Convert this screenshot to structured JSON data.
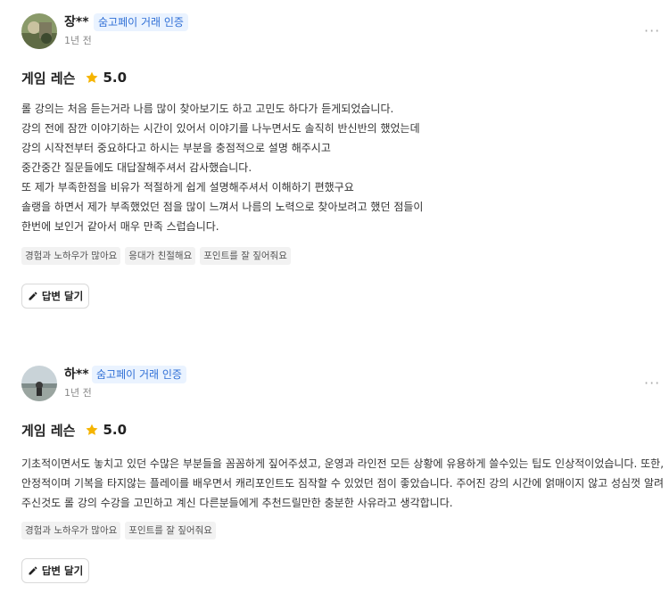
{
  "reviews": [
    {
      "name": "장**",
      "badge": "숨고페이 거래 인증",
      "time": "1년 전",
      "more": "···",
      "title": "게임 레슨",
      "rating": 5.0,
      "rating_text": "5.0",
      "lines": [
        "롤 강의는 처음 듣는거라 나름 많이 찾아보기도 하고 고민도 하다가 듣게되었습니다.",
        "강의 전에 잠깐 이야기하는 시간이 있어서 이야기를 나누면서도 솔직히 반신반의 했었는데",
        "강의 시작전부터 중요하다고 하시는 부분을 충점적으로 설명 해주시고",
        "중간중간 질문들에도 대답잘해주셔서 감사했습니다.",
        "또 제가 부족한점을 비유가 적절하게 쉽게 설명해주셔서 이해하기 편했구요",
        "솔랭을 하면서 제가 부족했었던 점을 많이 느껴서 나름의 노력으로 찾아보려고 했던 점들이",
        "한번에 보인거 같아서 매우 만족 스럽습니다."
      ],
      "tags": [
        "경험과 노하우가 많아요",
        "응대가 친절해요",
        "포인트를 잘 짚어줘요"
      ],
      "reply_label": "답변 달기"
    },
    {
      "name": "하**",
      "badge": "숨고페이 거래 인증",
      "time": "1년 전",
      "more": "···",
      "title": "게임 레슨",
      "rating": 5.0,
      "rating_text": "5.0",
      "paragraph": "기초적이면서도 놓치고 있던 수많은 부분들을 꼼꼼하게 짚어주셨고, 운영과 라인전 모든 상황에 유용하게 쓸수있는 팁도 인상적이었습니다. 또한, 안정적이며 기복을 타지않는 플레이를 배우면서 캐리포인트도 짐작할 수 있었던 점이 좋았습니다. 주어진 강의 시간에 얽매이지 않고 성심껏 알려주신것도 롤 강의 수강을 고민하고 계신 다른분들에게 추천드릴만한 충분한 사유라고 생각합니다.",
      "tags": [
        "경험과 노하우가 많아요",
        "포인트를 잘 짚어줘요"
      ],
      "reply_label": "답변 달기"
    }
  ],
  "colors": {
    "badge_text": "#2f6fd6",
    "badge_bg": "#eaf3ff",
    "star": "#f5b400"
  },
  "icons": {
    "star": "star-icon",
    "pencil": "pencil-icon",
    "more": "more-options-icon"
  }
}
